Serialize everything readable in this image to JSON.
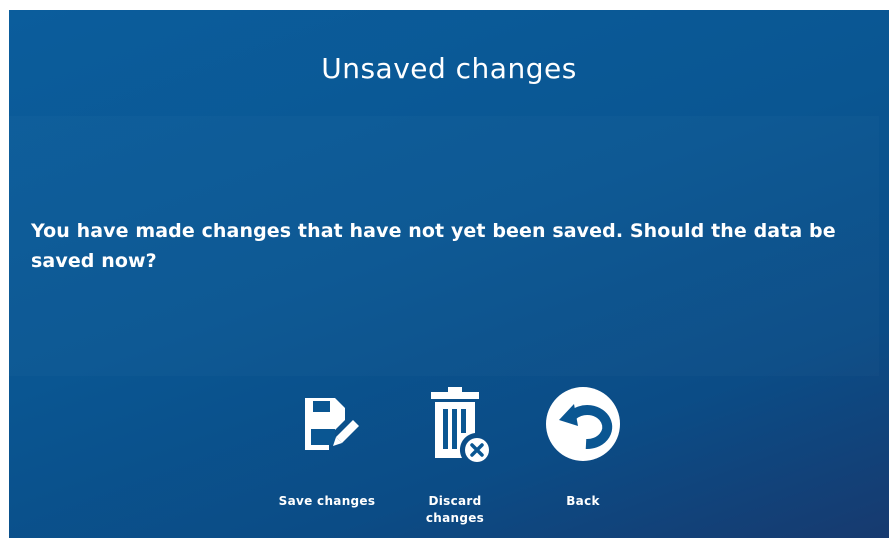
{
  "dialog": {
    "title": "Unsaved changes",
    "message": "You have made changes that have not yet been saved. Should the data be saved now?"
  },
  "actions": {
    "save": {
      "label": "Save changes",
      "icon": "floppy-edit-icon"
    },
    "discard": {
      "label": "Discard\nchanges",
      "icon": "trash-x-icon"
    },
    "back": {
      "label": "Back",
      "icon": "undo-arrow-icon"
    }
  },
  "colors": {
    "background": "#0a5692",
    "text": "#ffffff"
  }
}
